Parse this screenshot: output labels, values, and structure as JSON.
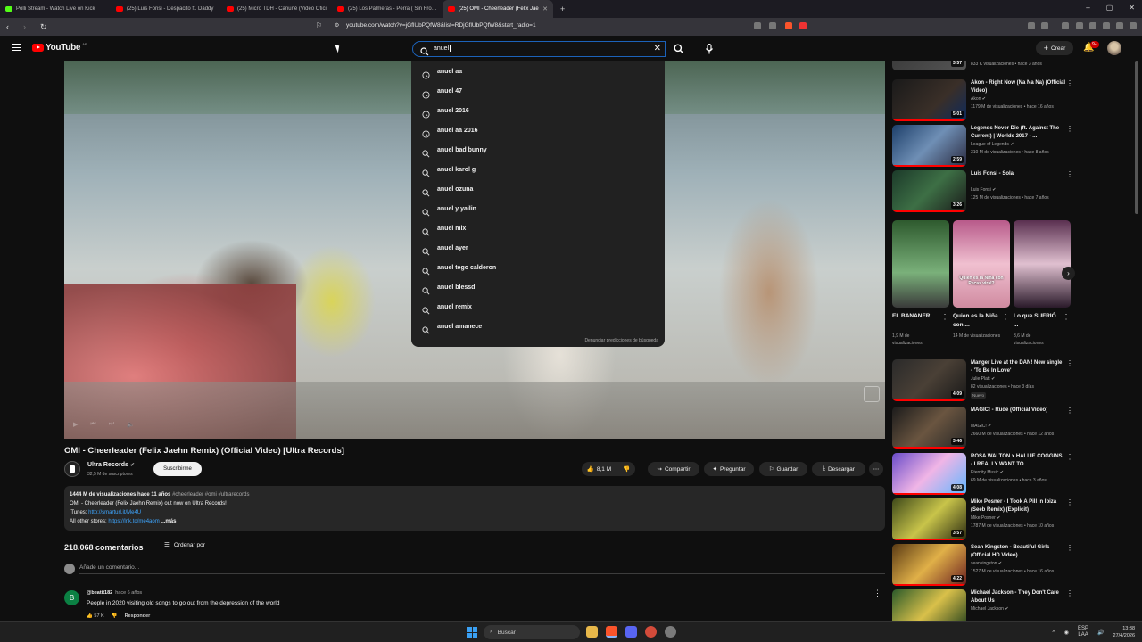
{
  "browser": {
    "tabs": [
      {
        "title": "Polli Stream - Watch Live on Kick",
        "active": false
      },
      {
        "title": "(25) Luis Fonsi - Despacito ft. Daddy",
        "active": false
      },
      {
        "title": "(25) Micro TDH - Cañuné (Video Ofici",
        "active": false
      },
      {
        "title": "(25) Los Palmeras - Perra ( Sin Fronte",
        "active": false
      },
      {
        "title": "(25) OMI - Cheerleader (Felix Jae",
        "active": true
      }
    ],
    "new_tab": "+",
    "url": "youtube.com/watch?v=jGflUbPQfW8&list=RDjGflUbPQfW8&start_radio=1"
  },
  "header": {
    "logo_text": "YouTube",
    "logo_country": "AR",
    "search_query": "anuel",
    "create_label": "Crear",
    "notifications_badge": "9+"
  },
  "suggestions": {
    "items": [
      {
        "text": "anuel aa",
        "type": "history"
      },
      {
        "text": "anuel 47",
        "type": "history"
      },
      {
        "text": "anuel 2016",
        "type": "history"
      },
      {
        "text": "anuel aa 2016",
        "type": "history"
      },
      {
        "text": "anuel bad bunny",
        "type": "search"
      },
      {
        "text": "anuel karol g",
        "type": "search"
      },
      {
        "text": "anuel ozuna",
        "type": "search"
      },
      {
        "text": "anuel y yailin",
        "type": "search"
      },
      {
        "text": "anuel mix",
        "type": "search"
      },
      {
        "text": "anuel ayer",
        "type": "search"
      },
      {
        "text": "anuel tego calderon",
        "type": "search"
      },
      {
        "text": "anuel blessd",
        "type": "search"
      },
      {
        "text": "anuel remix",
        "type": "search"
      },
      {
        "text": "anuel amanece",
        "type": "search"
      }
    ],
    "report_label": "Denunciar predicciones de búsqueda"
  },
  "video": {
    "title": "OMI - Cheerleader (Felix Jaehn Remix) (Official Video) [Ultra Records]",
    "channel": "Ultra Records",
    "subscribers": "32,5 M de suscriptores",
    "subscribe_label": "Suscribirme",
    "likes": "8,1 M",
    "share_label": "Compartir",
    "ask_label": "Preguntar",
    "save_label": "Guardar",
    "download_label": "Descargar"
  },
  "description": {
    "views_line": "1444 M de visualizaciones  hace 11 años",
    "hashtags": "#cheerleader #omi #ultrarecords",
    "line1": "OMI - Cheerleader (Felix Jaehn Remix) out now on Ultra Records!",
    "itunes_label": "iTunes: ",
    "itunes_link": "http://smarturl.it/Me4U",
    "other_label": "All other stores: ",
    "other_link": "https://lnk.to/me4aom",
    "more": "...más"
  },
  "comments": {
    "count": "218.068 comentarios",
    "sort_label": "Ordenar por",
    "add_placeholder": "Añade un comentario...",
    "first": {
      "avatar_letter": "B",
      "author": "@beatit182",
      "time": "hace 6 años",
      "text": "People in 2020 visiting old songs to go out from the depression of the world",
      "likes": "57 K",
      "reply_label": "Responder"
    }
  },
  "sidebar": {
    "top_partial": {
      "meta": "833 K visualizaciones • hace 3 años",
      "duration": "3:57"
    },
    "recs": [
      {
        "title": "Akon - Right Now (Na Na Na) (Official Video)",
        "channel": "Akon",
        "meta": "1179 M de visualizaciones • hace 16 años",
        "duration": "5:01",
        "badge": ""
      },
      {
        "title": "Legends Never Die (ft. Against The Current) | Worlds 2017 - ...",
        "channel": "League of Legends",
        "meta": "310 M de visualizaciones • hace 8 años",
        "duration": "2:59",
        "badge": ""
      },
      {
        "title": "Luis Fonsi - Sola",
        "channel": "Luis Fonsi",
        "meta": "125 M de visualizaciones • hace 7 años",
        "duration": "3:26",
        "badge": ""
      },
      {
        "title": "Manger Live at the DAN! New single - 'To Be In Love'",
        "channel": "Julie Platt",
        "meta": "82 visualizaciones • hace 3 días",
        "duration": "4:09",
        "badge": "Nuevo"
      },
      {
        "title": "MAGIC! - Rude (Official Video)",
        "channel": "MAGIC!",
        "meta": "2660 M de visualizaciones • hace 12 años",
        "duration": "3:46",
        "badge": ""
      },
      {
        "title": "ROSA WALTON x HALLIE COGGINS - I REALLY WANT TO...",
        "channel": "Eternity Music",
        "meta": "69 M de visualizaciones • hace 3 años",
        "duration": "4:08",
        "badge": ""
      },
      {
        "title": "Mike Posner - I Took A Pill In Ibiza (Seeb Remix) (Explicit)",
        "channel": "Mike Posner",
        "meta": "1787 M de visualizaciones • hace 10 años",
        "duration": "3:57",
        "badge": ""
      },
      {
        "title": "Sean Kingston - Beautiful Girls (Official HD Video)",
        "channel": "seankingston",
        "meta": "1527 M de visualizaciones • hace 16 años",
        "duration": "4:22",
        "badge": ""
      },
      {
        "title": "Michael Jackson - They Don't Care About Us",
        "channel": "Michael Jackson",
        "meta": "",
        "duration": "",
        "badge": ""
      }
    ],
    "shorts": [
      {
        "title": "EL BANANER...",
        "views": "1,9 M de visualizaciones",
        "overlay": ""
      },
      {
        "title": "Quien es la Niña con ...",
        "views": "14 M de visualizaciones",
        "overlay": "Quien es la Niña con Pecas viral?"
      },
      {
        "title": "Lo que SUFRIÓ ...",
        "views": "3,6 M de visualizaciones",
        "overlay": ""
      }
    ]
  },
  "taskbar": {
    "search_label": "Buscar",
    "lang": "ESP",
    "lang2": "LAA",
    "time": "13:38",
    "date": "27/4/2026"
  },
  "colors": {
    "accent": "#ff0000",
    "link": "#3ea6ff",
    "bg": "#0f0f0f",
    "surface": "#272727"
  }
}
